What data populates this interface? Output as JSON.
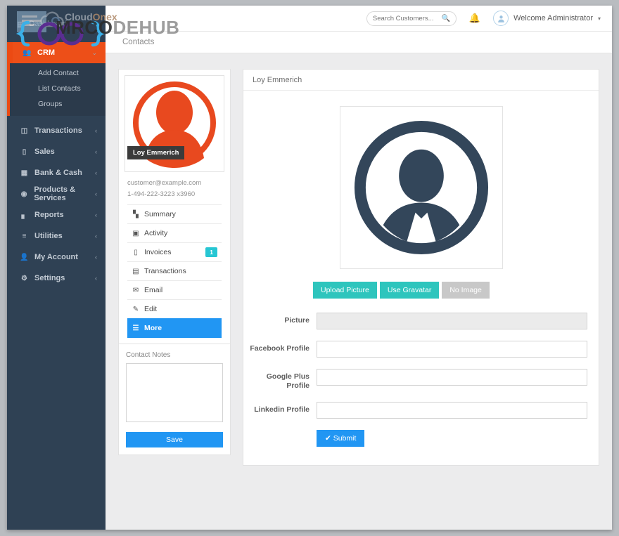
{
  "watermark": {
    "brand_cloud": "Cloud",
    "brand_cloud_accent": "Onex",
    "title_dark": "MRCO",
    "title_light": "DEHUB"
  },
  "sidebar": {
    "brand_label": "Dashboard",
    "items": [
      {
        "label": "CRM",
        "icon": "users-icon",
        "active": true,
        "chevron": "⌄",
        "subitems": [
          {
            "label": "Add Contact"
          },
          {
            "label": "List Contacts"
          },
          {
            "label": "Groups"
          }
        ]
      },
      {
        "label": "Transactions",
        "icon": "database-icon",
        "chevron": "‹"
      },
      {
        "label": "Sales",
        "icon": "credit-card-icon",
        "chevron": "‹"
      },
      {
        "label": "Bank & Cash",
        "icon": "bank-icon",
        "chevron": "‹"
      },
      {
        "label": "Products & Services",
        "icon": "box-icon",
        "chevron": "‹"
      },
      {
        "label": "Reports",
        "icon": "bar-chart-icon",
        "chevron": "‹"
      },
      {
        "label": "Utilities",
        "icon": "sliders-icon",
        "chevron": "‹"
      },
      {
        "label": "My Account",
        "icon": "user-icon",
        "chevron": "‹"
      },
      {
        "label": "Settings",
        "icon": "settings-icon",
        "chevron": "‹"
      }
    ]
  },
  "topbar": {
    "search_placeholder": "Search Customers...",
    "search_value": "",
    "search_icon": "search-icon",
    "bell_icon": "bell-icon",
    "user_label": "Welcome Administrator",
    "caret": "▾"
  },
  "breadcrumb": {
    "current": "Contacts"
  },
  "contact_card": {
    "name_tag": "Loy Emmerich",
    "email": "customer@example.com",
    "phone": "1-494-222-3223 x3960",
    "menu": [
      {
        "label": "Summary",
        "icon": "bar-chart-icon",
        "badge": null,
        "active": false
      },
      {
        "label": "Activity",
        "icon": "list-alt-icon",
        "badge": null,
        "active": false
      },
      {
        "label": "Invoices",
        "icon": "credit-card-icon",
        "badge": "1",
        "active": false
      },
      {
        "label": "Transactions",
        "icon": "list-icon",
        "badge": null,
        "active": false
      },
      {
        "label": "Email",
        "icon": "envelope-icon",
        "badge": null,
        "active": false
      },
      {
        "label": "Edit",
        "icon": "pencil-icon",
        "badge": null,
        "active": false
      },
      {
        "label": "More",
        "icon": "bars-icon",
        "badge": null,
        "active": true
      }
    ],
    "notes_label": "Contact Notes",
    "notes_value": "",
    "save_label": "Save"
  },
  "panel": {
    "title": "Loy Emmerich",
    "picture_icon": "user-tie-avatar-icon",
    "buttons": [
      {
        "label": "Upload Picture",
        "style": "teal"
      },
      {
        "label": "Use Gravatar",
        "style": "teal"
      },
      {
        "label": "No Image",
        "style": "gray"
      }
    ],
    "fields": [
      {
        "label": "Picture",
        "value": "",
        "disabled": true
      },
      {
        "label": "Facebook Profile",
        "value": "",
        "disabled": false
      },
      {
        "label": "Google Plus Profile",
        "value": "",
        "disabled": false
      },
      {
        "label": "Linkedin Profile",
        "value": "",
        "disabled": false
      }
    ],
    "submit_label": "✔ Submit"
  },
  "colors": {
    "sidebar_bg": "#2f4154",
    "active_orange": "#ed4f18",
    "accent_blue": "#2196f3",
    "teal": "#2ec5bd",
    "badge_teal": "#27c6d3",
    "avatar_orange": "#e8491f",
    "avatar_navy": "#33465a"
  }
}
